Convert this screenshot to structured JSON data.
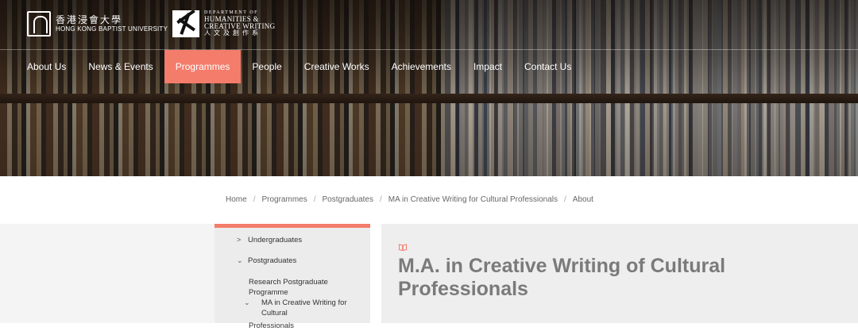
{
  "university": {
    "name_cn": "香港浸會大學",
    "name_en": "HONG KONG BAPTIST UNIVERSITY"
  },
  "department": {
    "line1": "DEPARTMENT OF",
    "line2": "HUMANITIES &",
    "line3": "CREATIVE WRITING",
    "line4_cn": "人文及創作系"
  },
  "nav": {
    "items": [
      {
        "label": "About Us"
      },
      {
        "label": "News & Events"
      },
      {
        "label": "Programmes"
      },
      {
        "label": "People"
      },
      {
        "label": "Creative Works"
      },
      {
        "label": "Achievements"
      },
      {
        "label": "Impact"
      },
      {
        "label": "Contact Us"
      }
    ],
    "active": "Programmes"
  },
  "breadcrumb": {
    "items": [
      "Home",
      "Programmes",
      "Postgraduates",
      "MA in Creative Writing for Cultural Professionals",
      "About"
    ],
    "separator": "/"
  },
  "sidebar": {
    "items": [
      {
        "label": "Undergraduates"
      },
      {
        "label": "Postgraduates"
      },
      {
        "label": "Research Postgraduate Programme"
      },
      {
        "label_line1": "MA in Creative Writing for Cultural",
        "label_line2": "Professionals"
      }
    ]
  },
  "content": {
    "icon": "book-icon",
    "title": "M.A. in Creative Writing of Cultural Professionals"
  },
  "colors": {
    "accent": "#f47c6a",
    "title": "#7a7a7a",
    "content_bg": "#eeeeee",
    "sidebar_bg": "#ececec"
  }
}
